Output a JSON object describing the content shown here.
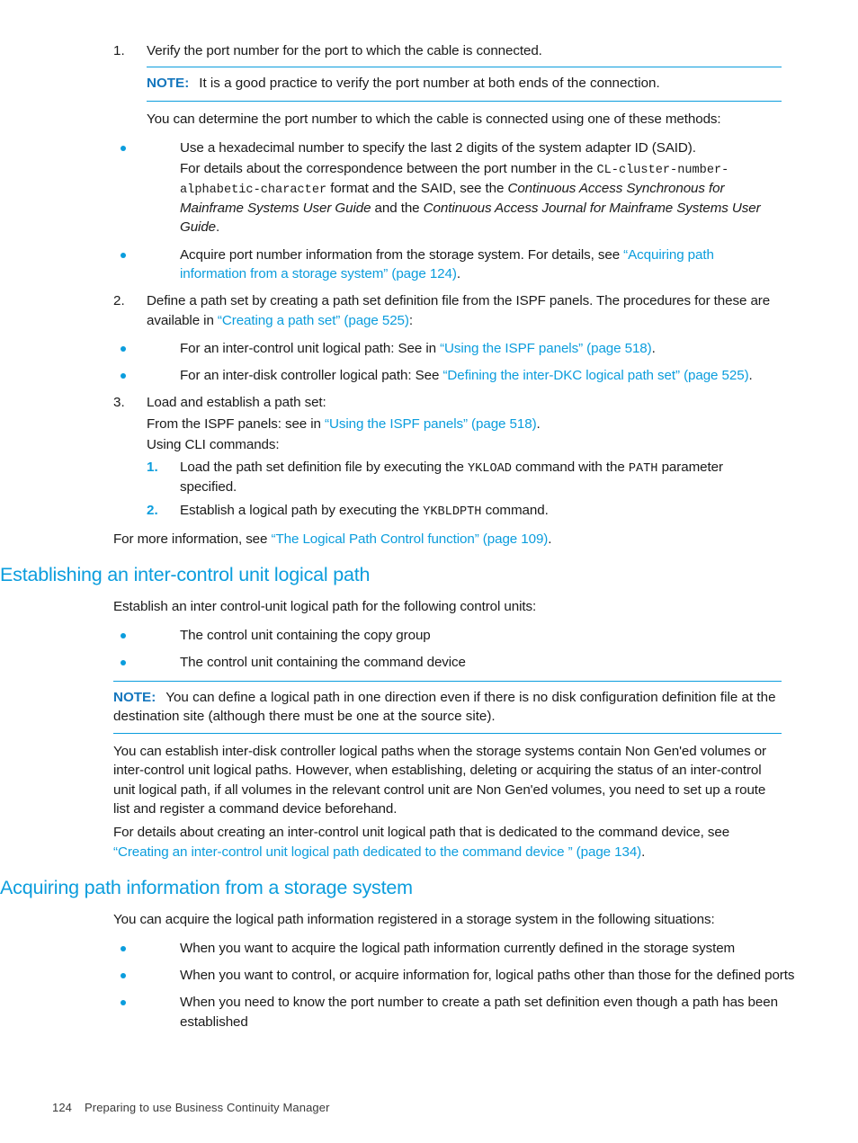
{
  "document": {
    "footer": {
      "page_number": "124",
      "chapter_title": "Preparing to use Business Continuity Manager"
    }
  },
  "colors": {
    "accent": "#0b9ddd",
    "note_label": "#1476bd",
    "body_text": "#1a1a1a"
  },
  "steps": {
    "step1": {
      "number": "1.",
      "text": "Verify the port number for the port to which the cable is connected."
    },
    "note1": {
      "label": "NOTE:",
      "text": "It is a good practice to verify the port number at both ends of the connection."
    },
    "methods_intro": "You can determine the port number to which the cable is connected using one of these methods:",
    "method1": {
      "line1": "Use a hexadecimal number to specify the last 2 digits of the system adapter ID (SAID).",
      "line2_a": "For details about the correspondence between the port number in the ",
      "line2_code": "CL-cluster-number-alphabetic-character",
      "line2_b": " format and the SAID, see the ",
      "line2_italic1": "Continuous Access Synchronous for Mainframe Systems User Guide",
      "line2_c": " and the ",
      "line2_italic2": "Continuous Access Journal for Mainframe Systems User Guide",
      "line2_d": "."
    },
    "method2": {
      "text_a": "Acquire port number information from the storage system. For details, see ",
      "link": "“Acquiring path information from a storage system” (page 124)",
      "text_b": "."
    },
    "step2": {
      "number": "2.",
      "text_a": "Define a path set by creating a path set definition file from the ISPF panels. The procedures for these are available in ",
      "link": "“Creating a path set” (page 525)",
      "text_b": ":"
    },
    "step2_bullets": [
      {
        "text_a": "For an inter-control unit logical path: See in ",
        "link": "“Using the ISPF panels” (page 518)",
        "text_b": "."
      },
      {
        "text_a": "For an inter-disk controller logical path: See ",
        "link": "“Defining the inter-DKC logical path set” (page 525)",
        "text_b": "."
      }
    ],
    "step3": {
      "number": "3.",
      "text": "Load and establish a path set:",
      "ispf_line_a": "From the ISPF panels: see in ",
      "ispf_link": "“Using the ISPF panels” (page 518)",
      "ispf_line_b": ".",
      "cli_line": "Using CLI commands:",
      "substeps": [
        {
          "number": "1.",
          "text_a": "Load the path set definition file by executing the ",
          "code1": "YKLOAD",
          "text_b": " command with the ",
          "code2": "PATH",
          "text_c": " parameter specified."
        },
        {
          "number": "2.",
          "text_a": "Establish a logical path by executing the ",
          "code1": "YKBLDPTH",
          "text_b": " command."
        }
      ]
    },
    "more_info": {
      "text_a": "For more information, see ",
      "link": "“The Logical Path Control function” (page 109)",
      "text_b": "."
    }
  },
  "section_establishing": {
    "heading": "Establishing an inter-control unit logical path",
    "intro": "Establish an inter control-unit logical path for the following control units:",
    "bullets": [
      "The control unit containing the copy group",
      "The control unit containing the command device"
    ],
    "note": {
      "label": "NOTE:",
      "text": "You can define a logical path in one direction even if there is no disk configuration definition file at the destination site (although there must be one at the source site)."
    },
    "para1": "You can establish inter-disk controller logical paths when the storage systems contain Non Gen'ed volumes or inter-control unit logical paths. However, when establishing, deleting or acquiring the status of an inter-control unit logical path, if all volumes in the relevant control unit are Non Gen'ed volumes, you need to set up a route list and register a command device beforehand.",
    "para2": {
      "text_a": "For details about creating an inter-control unit logical path that is dedicated to the command device, see ",
      "link": "“Creating an inter-control unit logical path dedicated to the command device ” (page 134)",
      "text_b": "."
    }
  },
  "section_acquiring": {
    "heading": "Acquiring path information from a storage system",
    "intro": "You can acquire the logical path information registered in a storage system in the following situations:",
    "bullets": [
      "When you want to acquire the logical path information currently defined in the storage system",
      "When you want to control, or acquire information for, logical paths other than those for the defined ports",
      "When you need to know the port number to create a path set definition even though a path has been established"
    ]
  }
}
